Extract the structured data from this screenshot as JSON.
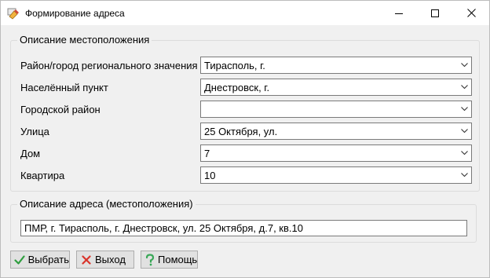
{
  "window": {
    "title": "Формирование адреса"
  },
  "location_group": {
    "title": "Описание местоположения",
    "rows": [
      {
        "label": "Район/город регионального значения",
        "value": "Тирасполь, г."
      },
      {
        "label": "Населённый пункт",
        "value": "Днестровск, г."
      },
      {
        "label": "Городской район",
        "value": ""
      },
      {
        "label": "Улица",
        "value": "25 Октября, ул."
      },
      {
        "label": "Дом",
        "value": "7"
      },
      {
        "label": "Квартира",
        "value": "10"
      }
    ]
  },
  "address_group": {
    "title": "Описание адреса (местоположения)",
    "value": "ПМР, г. Тирасполь, г. Днестровск, ул. 25 Октября, д.7, кв.10"
  },
  "buttons": {
    "select_label": "Выбрать",
    "exit_label": "Выход",
    "help_label": "Помощь"
  },
  "icons": {
    "select": "checkmark-icon",
    "exit": "cross-icon",
    "help": "question-icon"
  },
  "colors": {
    "check_green": "#2e9e3e",
    "cross_red": "#d9342b",
    "question_green": "#3aa858"
  }
}
